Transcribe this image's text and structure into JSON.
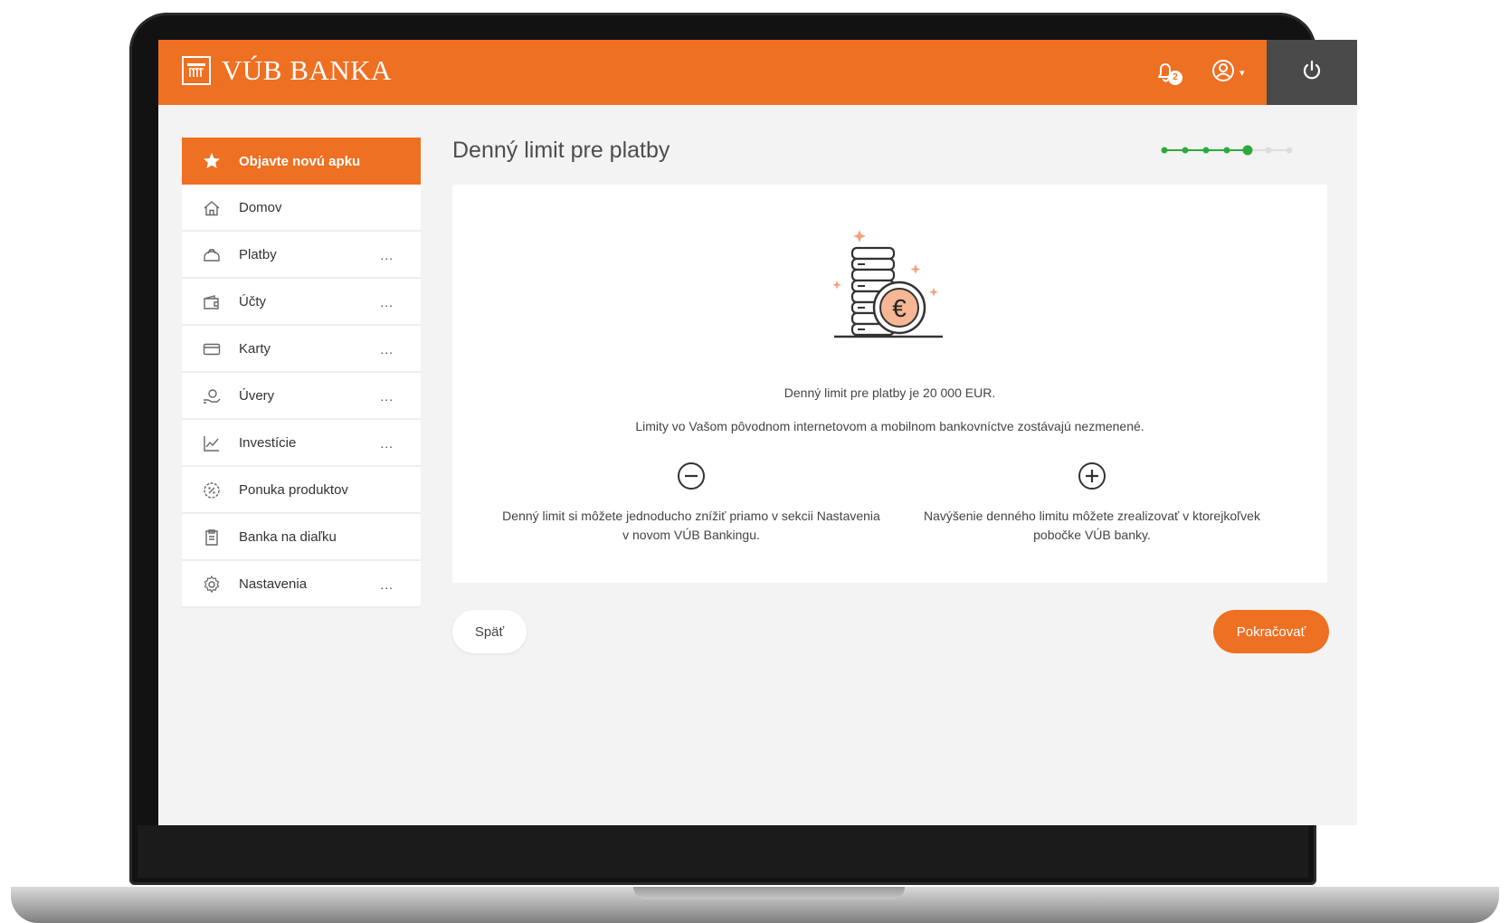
{
  "header": {
    "brand": "VÚB BANKA",
    "notifications_count": "2",
    "accent_color": "#ee7023",
    "icons": [
      "bank-logo-icon",
      "bell-icon",
      "user-icon",
      "power-icon"
    ]
  },
  "sidebar": {
    "items": [
      {
        "label": "Objavte novú apku",
        "icon": "star-icon",
        "active": true,
        "more": ""
      },
      {
        "label": "Domov",
        "icon": "home-icon",
        "more": ""
      },
      {
        "label": "Platby",
        "icon": "payment-icon",
        "more": "..."
      },
      {
        "label": "Účty",
        "icon": "wallet-icon",
        "more": "..."
      },
      {
        "label": "Karty",
        "icon": "card-icon",
        "more": "..."
      },
      {
        "label": "Úvery",
        "icon": "loan-icon",
        "more": "..."
      },
      {
        "label": "Investície",
        "icon": "chart-icon",
        "more": "..."
      },
      {
        "label": "Ponuka produktov",
        "icon": "offer-icon",
        "more": ""
      },
      {
        "label": "Banka na diaľku",
        "icon": "document-icon",
        "more": ""
      },
      {
        "label": "Nastavenia",
        "icon": "gear-icon",
        "more": "..."
      }
    ]
  },
  "main": {
    "title": "Denný limit pre platby",
    "stepper": {
      "total": 7,
      "completed": 5
    },
    "info_main": "Denný limit pre platby je 20 000 EUR.",
    "info_sub": "Limity vo Vašom pôvodnom internetovom a mobilnom bankovníctve zostávajú nezmenené.",
    "decrease_text": "Denný limit si môžete jednoducho znížiť priamo v sekcii Nastavenia v novom VÚB Bankingu.",
    "increase_text": "Navýšenie denného limitu môžete zrealizovať v ktorejkoľvek pobočke VÚB banky.",
    "back_label": "Späť",
    "continue_label": "Pokračovať"
  }
}
